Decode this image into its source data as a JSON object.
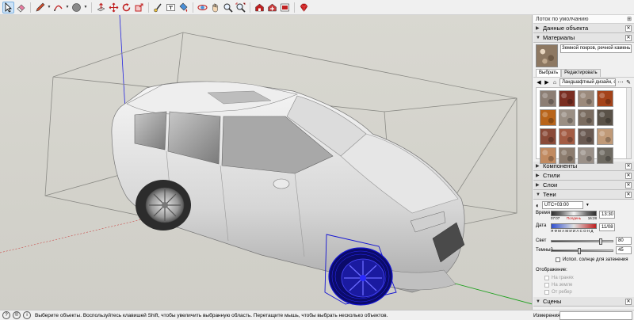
{
  "toolbar": {
    "tools": [
      {
        "name": "select-tool",
        "icon": "arrow-icon"
      },
      {
        "name": "eraser-tool",
        "icon": "eraser-icon"
      },
      {
        "name": "pencil-line-tool",
        "icon": "pencil-icon"
      },
      {
        "name": "arc-tool",
        "icon": "arc-icon"
      },
      {
        "name": "shape-tool",
        "icon": "circle-shape-icon"
      },
      {
        "name": "push-pull-tool",
        "icon": "push-pull-icon"
      },
      {
        "name": "move-tool",
        "icon": "move-icon"
      },
      {
        "name": "rotate-tool",
        "icon": "rotate-icon"
      },
      {
        "name": "scale-tool",
        "icon": "scale-icon"
      },
      {
        "name": "tape-measure-tool",
        "icon": "tape-icon"
      },
      {
        "name": "text-tool",
        "icon": "text-icon"
      },
      {
        "name": "paint-bucket-tool",
        "icon": "bucket-icon"
      },
      {
        "name": "orbit-tool",
        "icon": "orbit-icon"
      },
      {
        "name": "pan-tool",
        "icon": "hand-icon"
      },
      {
        "name": "zoom-tool",
        "icon": "zoom-icon"
      },
      {
        "name": "zoom-extents-tool",
        "icon": "zoom-extents-icon"
      },
      {
        "name": "warehouse-tool",
        "icon": "warehouse-icon"
      },
      {
        "name": "extension-warehouse-tool",
        "icon": "extension-icon"
      },
      {
        "name": "send-to-layout-tool",
        "icon": "layout-icon"
      },
      {
        "name": "ruby-tool",
        "icon": "ruby-icon"
      }
    ]
  },
  "tray": {
    "title": "Лоток по умолчанию",
    "entity_info": "Данные объекта",
    "materials": {
      "title": "Материалы",
      "current_name": "Земной покров, речной камень",
      "tab_select": "Выбрать",
      "tab_edit": "Редактировать",
      "library": "Ландшафтный дизайн, огр"
    },
    "components": "Компоненты",
    "styles": "Стили",
    "layers": "Слои",
    "shadows": {
      "title": "Тени",
      "utc": "UTC+03:00",
      "time_label": "Время",
      "time_start": "07:07",
      "time_noon": "Полдень",
      "time_end": "16:28",
      "time_value": "13:30",
      "date_label": "Дата",
      "months": "Я Ф М А М И И А С О Н Д",
      "date_value": "11/08",
      "light_label": "Свет",
      "light_value": "80",
      "dark_label": "Темный",
      "dark_value": "45",
      "use_sun": "Испол. солнце для затенения",
      "display_label": "Отображение:",
      "on_faces": "На гранях",
      "on_ground": "На земле",
      "from_edges": "От ребер"
    },
    "scenes": "Сцены"
  },
  "status": {
    "message": "Выберите объекты. Воспользуйтесь клавишей Shift, чтобы увеличить выбранную область. Перетащите мышь, чтобы выбрать несколько объектов.",
    "measure_label": "Измерения",
    "measure_value": ""
  },
  "colors": {
    "viewport_bg": "#d5d4cd",
    "selection_blue": "#1414d2",
    "axis_green": "#1ea01e",
    "axis_red": "#c82828",
    "axis_blue": "#2020e0"
  },
  "materials_swatches": [
    "#8c7e74",
    "#7a2e22",
    "#9b8a7c",
    "#a4431a",
    "#b8641a",
    "#9a8f84",
    "#7a6c60",
    "#5a5248",
    "#8a4a38",
    "#a35c44",
    "#6a5a52",
    "#c09a78",
    "#c18a60",
    "#8c7c6e",
    "#9a9088",
    "#6e6a62"
  ]
}
